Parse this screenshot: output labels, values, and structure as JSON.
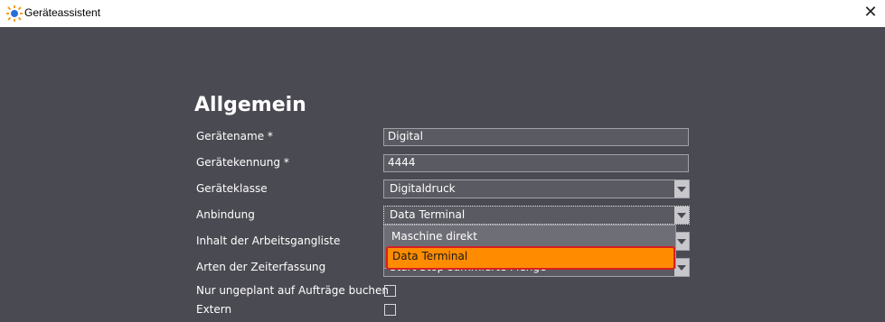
{
  "window": {
    "title": "Geräteassistent",
    "app_icon": "sun-gear-icon",
    "close_glyph": "✕"
  },
  "section": {
    "title": "Allgemein"
  },
  "form": {
    "geraetename": {
      "label": "Gerätename *",
      "value": "Digital"
    },
    "geraetekennung": {
      "label": "Gerätekennung *",
      "value": "4444"
    },
    "geraeteklasse": {
      "label": "Geräteklasse",
      "value": "Digitaldruck"
    },
    "anbindung": {
      "label": "Anbindung",
      "value": "Data Terminal",
      "options": [
        "Maschine direkt",
        "Data Terminal"
      ],
      "highlighted": "Data Terminal"
    },
    "inhalt": {
      "label": "Inhalt der Arbeitsgangliste",
      "value": ""
    },
    "zeiterfassung": {
      "label": "Arten der Zeiterfassung",
      "value": "Start Stop summierte Menge"
    },
    "nur_ungeplant": {
      "label": "Nur ungeplant auf Aufträge buchen",
      "checked": false
    },
    "extern": {
      "label": "Extern",
      "checked": false
    }
  },
  "colors": {
    "background": "#4a4a52",
    "highlight": "#ff8c00",
    "highlight_border": "#d62020"
  }
}
